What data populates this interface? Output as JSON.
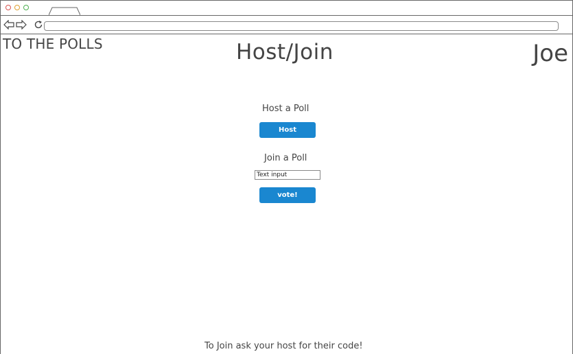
{
  "browser": {
    "url_value": "",
    "icons": {
      "close": "close-dot-icon",
      "minimize": "minimize-dot-icon",
      "maximize": "maximize-dot-icon",
      "back": "back-arrow-icon",
      "forward": "forward-arrow-icon",
      "reload": "reload-icon"
    },
    "colors": {
      "close": "#d9534f",
      "minimize": "#e0a030",
      "maximize": "#4caf50"
    }
  },
  "header": {
    "brand": "TO THE POLLS",
    "title": "Host/Join",
    "user": "Joe"
  },
  "host": {
    "label": "Host a Poll",
    "button_label": "Host"
  },
  "join": {
    "label": "Join a Poll",
    "input_value": "Text input",
    "button_label": "vote!"
  },
  "footer": {
    "note": "To Join ask your host for their code!"
  },
  "theme": {
    "accent": "#1a87d0"
  }
}
